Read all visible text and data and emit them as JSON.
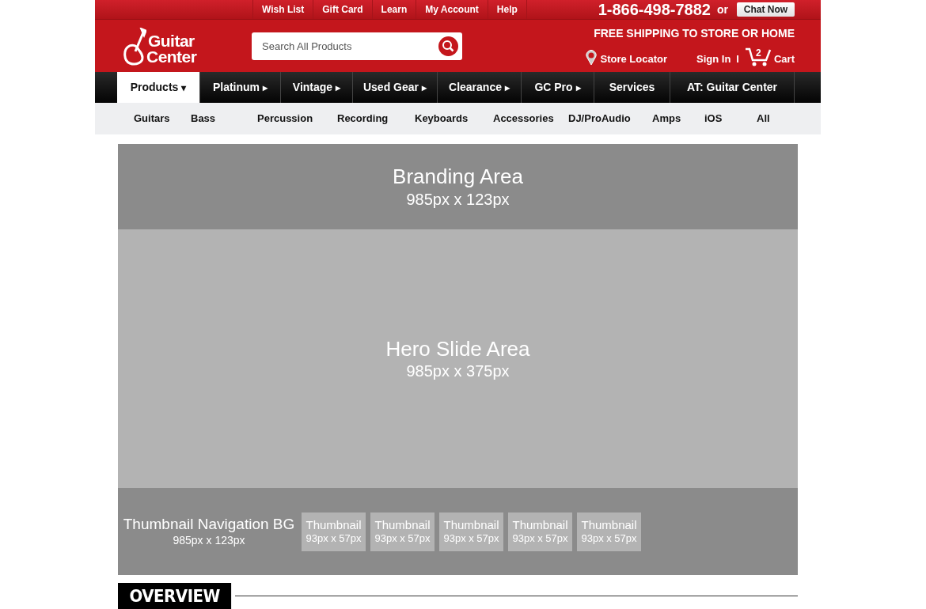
{
  "top_links": [
    "Wish List",
    "Gift Card",
    "Learn",
    "My Account",
    "Help"
  ],
  "phone": "1-866-498-7882",
  "phone_or": "or",
  "chat_button": "Chat Now",
  "logo": {
    "line_1": "Guitar",
    "line_2": "Center"
  },
  "search": {
    "placeholder": "Search All Products"
  },
  "shipping_banner": "FREE SHIPPING TO STORE OR HOME",
  "store_locator": "Store Locator",
  "sign_in": "Sign In",
  "separator": "I",
  "cart": {
    "label": "Cart",
    "count": "2"
  },
  "main_nav": [
    {
      "label": "Products",
      "selected": true,
      "arrow": "▾"
    },
    {
      "label": "Platinum",
      "selected": false,
      "arrow": "▸"
    },
    {
      "label": "Vintage",
      "selected": false,
      "arrow": "▸"
    },
    {
      "label": "Used Gear",
      "selected": false,
      "arrow": "▸"
    },
    {
      "label": "Clearance",
      "selected": false,
      "arrow": "▸"
    },
    {
      "label": "GC Pro",
      "selected": false,
      "arrow": "▸"
    },
    {
      "label": "Services",
      "selected": false
    },
    {
      "label": "AT: Guitar Center",
      "selected": false
    }
  ],
  "sub_nav": [
    "Guitars",
    "Bass",
    "Percussion",
    "Recording",
    "Keyboards",
    "Accessories",
    "DJ/ProAudio",
    "Amps",
    "iOS",
    "All"
  ],
  "branding_area": {
    "title": "Branding Area",
    "size": "985px x 123px"
  },
  "hero_area": {
    "title": "Hero Slide Area",
    "size": "985px x 375px"
  },
  "thumbnail_nav": {
    "title": "Thumbnail Navigation BG",
    "size": "985px x 123px",
    "thumbnails": [
      {
        "title": "Thumbnail",
        "size": "93px x 57px"
      },
      {
        "title": "Thumbnail",
        "size": "93px x 57px"
      },
      {
        "title": "Thumbnail",
        "size": "93px x 57px"
      },
      {
        "title": "Thumbnail",
        "size": "93px x 57px"
      },
      {
        "title": "Thumbnail",
        "size": "93px x 57px"
      }
    ]
  },
  "section_heading": "OVERVIEW"
}
